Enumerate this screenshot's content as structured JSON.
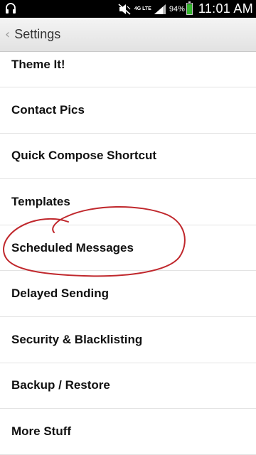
{
  "status_bar": {
    "network": "4G LTE",
    "battery_percent": "94%",
    "battery_level": 0.94,
    "time": "11:01 AM",
    "icons": [
      "headphones-icon",
      "mute-icon",
      "signal-icon",
      "battery-icon"
    ]
  },
  "action_bar": {
    "title": "Settings",
    "back_icon": "chevron-left-icon"
  },
  "settings_items": [
    {
      "label": "Theme It!"
    },
    {
      "label": "Contact Pics"
    },
    {
      "label": "Quick Compose Shortcut"
    },
    {
      "label": "Templates"
    },
    {
      "label": "Scheduled Messages"
    },
    {
      "label": "Delayed Sending"
    },
    {
      "label": "Security & Blacklisting"
    },
    {
      "label": "Backup / Restore"
    },
    {
      "label": "More Stuff"
    }
  ],
  "colors": {
    "annotation_circle": "#c0282d",
    "battery": "#36b52f"
  }
}
